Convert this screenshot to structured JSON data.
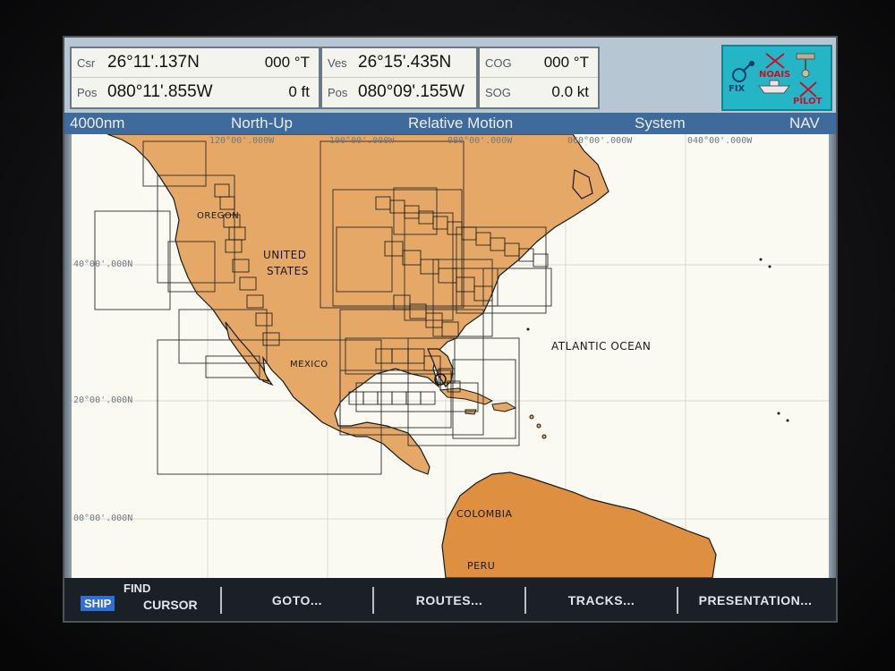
{
  "databar": {
    "cursor": {
      "label": "Csr",
      "lat": "26°11'.137N",
      "bearing": "000 °T"
    },
    "cursor_pos": {
      "label": "Pos",
      "lon": "080°11'.855W",
      "range": "0 ft"
    },
    "vessel": {
      "label": "Ves",
      "lat": "26°15'.435N"
    },
    "vessel_pos": {
      "label": "Pos",
      "lon": "080°09'.155W"
    },
    "cog": {
      "label": "COG",
      "value": "000 °T"
    },
    "sog": {
      "label": "SOG",
      "value": "0.0 kt"
    }
  },
  "status": {
    "fix": "FIX",
    "noais": "NOAIS",
    "pilot": "PILOT"
  },
  "titlebar": {
    "range": "4000nm",
    "orientation": "North-Up",
    "motion": "Relative Motion",
    "system": "System",
    "mode": "NAV"
  },
  "chart": {
    "longitudes": [
      "120°00'.000W",
      "100°00'.000W",
      "080°00'.000W",
      "060°00'.000W",
      "040°00'.000W"
    ],
    "latitudes": [
      "40°00'.000N",
      "20°00'.000N",
      "00°00'.000N"
    ],
    "places": {
      "united": "UNITED",
      "states": "STATES",
      "oregon": "OREGON",
      "mexico": "MEXICO",
      "atlantic": "ATLANTIC OCEAN",
      "colombia": "COLOMBIA",
      "peru": "PERU"
    },
    "colors": {
      "land": "#e6a866",
      "land_south": "#de8f40",
      "water": "#fbfaf2",
      "coast": "#1a1a1a"
    }
  },
  "softkeys": {
    "ship": "SHIP",
    "find": "FIND",
    "cursor": "CURSOR",
    "goto": "GOTO...",
    "routes": "ROUTES...",
    "tracks": "TRACKS...",
    "presentation": "PRESENTATION..."
  }
}
